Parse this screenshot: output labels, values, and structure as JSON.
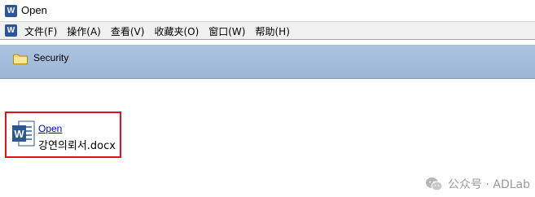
{
  "window": {
    "title": "Open",
    "app_icon": "word-icon"
  },
  "menubar": {
    "items": [
      {
        "label": "文件(F)"
      },
      {
        "label": "操作(A)"
      },
      {
        "label": "查看(V)"
      },
      {
        "label": "收藏夹(O)"
      },
      {
        "label": "窗口(W)"
      },
      {
        "label": "帮助(H)"
      }
    ]
  },
  "location": {
    "folder_icon": "folder-icon",
    "label": "Security"
  },
  "file": {
    "icon": "word-document-icon",
    "link_text": "Open",
    "name": "강연의뢰서.docx",
    "highlight_color": "#e0131a"
  },
  "watermark": {
    "icon": "wechat-icon",
    "text": "公众号 · ADLab"
  }
}
